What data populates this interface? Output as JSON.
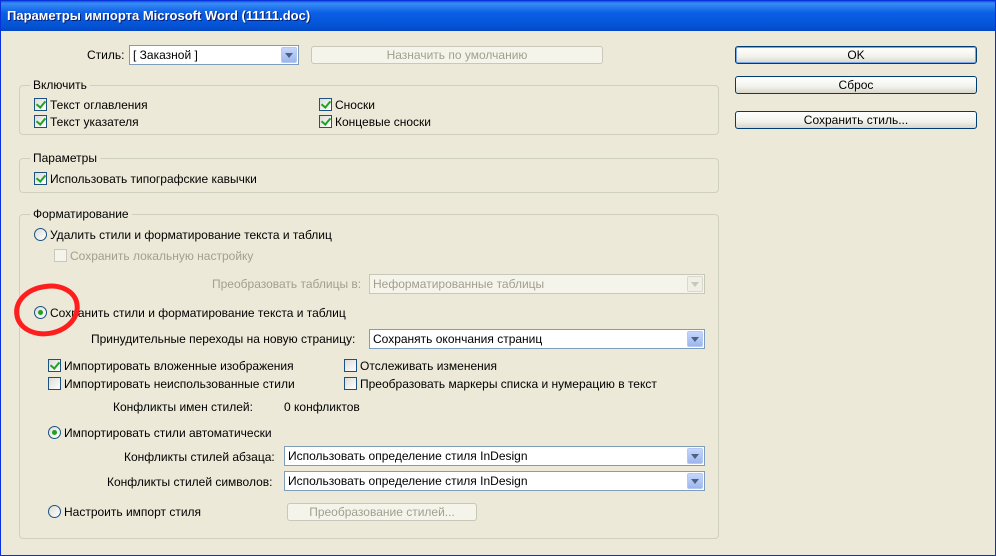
{
  "window": {
    "title": "Параметры импорта Microsoft Word (11111.doc)"
  },
  "style_row": {
    "label": "Стиль:",
    "value": "[ Заказной ]",
    "default_button": "Назначить по умолчанию"
  },
  "buttons": {
    "ok": "OK",
    "reset": "Сброс",
    "save_style": "Сохранить стиль..."
  },
  "include": {
    "title": "Включить",
    "toc_text": "Текст оглавления",
    "index_text": "Текст указателя",
    "footnotes": "Сноски",
    "endnotes": "Концевые сноски"
  },
  "options": {
    "title": "Параметры",
    "typographer_quotes": "Использовать типографские кавычки"
  },
  "formatting": {
    "title": "Форматирование",
    "remove_styles": "Удалить стили и форматирование текста и таблиц",
    "keep_local": "Сохранить локальную настройку",
    "convert_tables_label": "Преобразовать таблицы в:",
    "convert_tables_value": "Неформатированные таблицы",
    "keep_styles": "Сохранить стили и форматирование текста и таблиц",
    "page_breaks_label": "Принудительные переходы на новую страницу:",
    "page_breaks_value": "Сохранять окончания страниц",
    "import_inline_graphics": "Импортировать вложенные изображения",
    "import_unused_styles": "Импортировать неиспользованные стили",
    "track_changes": "Отслеживать изменения",
    "convert_bullets": "Преобразовать маркеры списка и нумерацию в текст",
    "style_conflicts_label": "Конфликты имен стилей:",
    "style_conflicts_value": "0 конфликтов",
    "import_styles_auto": "Импортировать стили автоматически",
    "para_conflicts_label": "Конфликты стилей абзаца:",
    "para_conflicts_value": "Использовать определение стиля InDesign",
    "char_conflicts_label": "Конфликты стилей символов:",
    "char_conflicts_value": "Использовать определение стиля InDesign",
    "customize_import": "Настроить импорт стиля",
    "style_mapping_button": "Преобразование стилей..."
  },
  "colors": {
    "window_bg": "#ece9d8",
    "title_blue": "#0454d6",
    "annotation_red": "#ff1e1e",
    "check_green": "#21a121"
  }
}
